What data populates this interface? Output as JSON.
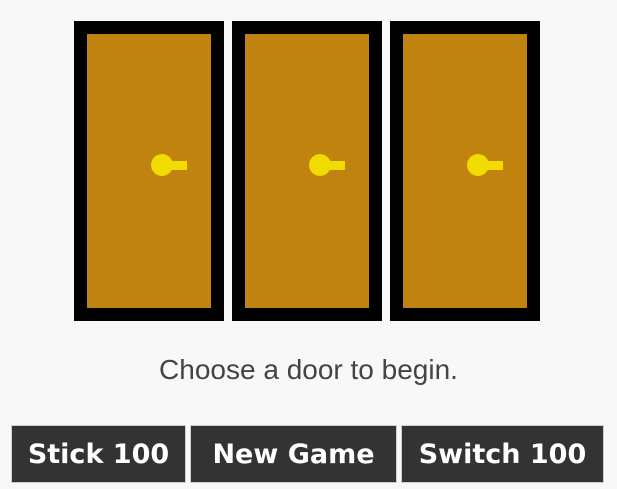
{
  "game": {
    "doors": [
      {
        "label": "door-1"
      },
      {
        "label": "door-2"
      },
      {
        "label": "door-3"
      }
    ],
    "message": "Choose a door to begin.",
    "colors": {
      "background": "#f8f8f8",
      "door_frame": "#000000",
      "door_panel": "#c08310",
      "knob": "#f0dc00",
      "button_bg": "#333333",
      "button_text": "#ffffff",
      "message_text": "#444444"
    }
  },
  "controls": {
    "stick_label": "Stick 100",
    "new_game_label": "New Game",
    "switch_label": "Switch 100"
  }
}
